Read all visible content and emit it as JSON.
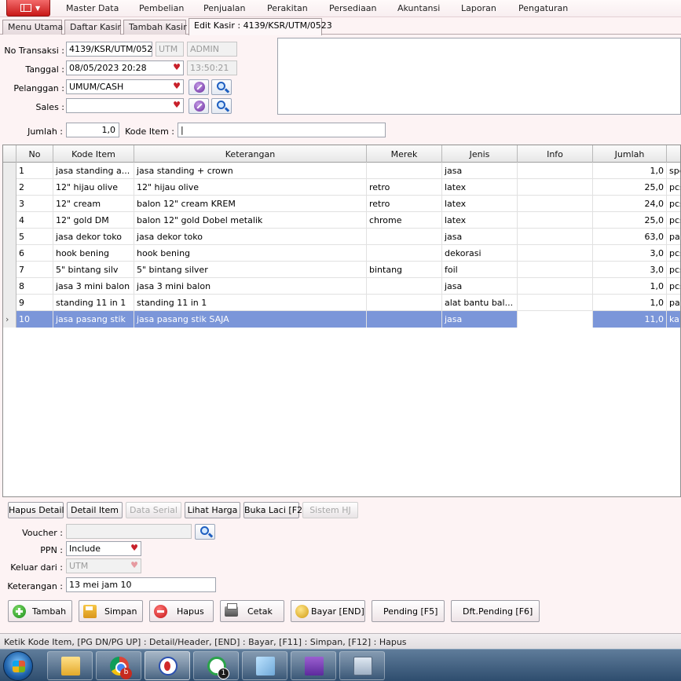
{
  "menu": {
    "items": [
      "Master Data",
      "Pembelian",
      "Penjualan",
      "Perakitan",
      "Persediaan",
      "Akuntansi",
      "Laporan",
      "Pengaturan"
    ]
  },
  "tabs": [
    "Menu Utama",
    "Daftar Kasir",
    "Tambah Kasir",
    "Edit Kasir : 4139/KSR/UTM/0523"
  ],
  "header": {
    "no_transaksi_label": "No Transaksi :",
    "no_transaksi": "4139/KSR/UTM/0523",
    "branch": "UTM",
    "user": "ADMIN",
    "tanggal_label": "Tanggal :",
    "tanggal": "08/05/2023 20:28",
    "time": "13:50:21",
    "pelanggan_label": "Pelanggan :",
    "pelanggan": "UMUM/CASH",
    "sales_label": "Sales :",
    "sales": "",
    "jumlah_label": "Jumlah :",
    "jumlah": "1,0",
    "kode_item_label": "Kode Item :",
    "kode_item": "|"
  },
  "grid": {
    "columns": [
      "No",
      "Kode Item",
      "Keterangan",
      "Merek",
      "Jenis",
      "Info",
      "Jumlah"
    ],
    "rows": [
      {
        "no": "1",
        "kode": "jasa standing a...",
        "ket": "jasa standing  + crown",
        "merek": "",
        "jenis": "jasa",
        "info": "",
        "jumlah": "1,0",
        "satuan": "spe"
      },
      {
        "no": "2",
        "kode": "12\" hijau olive",
        "ket": "12\" hijau olive",
        "merek": "retro",
        "jenis": "latex",
        "info": "",
        "jumlah": "25,0",
        "satuan": "pcs"
      },
      {
        "no": "3",
        "kode": "12\" cream",
        "ket": "balon 12\" cream KREM",
        "merek": "retro",
        "jenis": "latex",
        "info": "",
        "jumlah": "24,0",
        "satuan": "pcs"
      },
      {
        "no": "4",
        "kode": "12\" gold DM",
        "ket": "balon 12\" gold Dobel metalik",
        "merek": "chrome",
        "jenis": "latex",
        "info": "",
        "jumlah": "25,0",
        "satuan": "pcs"
      },
      {
        "no": "5",
        "kode": "jasa dekor toko",
        "ket": "jasa dekor toko",
        "merek": "",
        "jenis": "jasa",
        "info": "",
        "jumlah": "63,0",
        "satuan": "pa"
      },
      {
        "no": "6",
        "kode": "hook bening",
        "ket": "hook bening",
        "merek": "",
        "jenis": "dekorasi",
        "info": "",
        "jumlah": "3,0",
        "satuan": "pcs"
      },
      {
        "no": "7",
        "kode": "5\" bintang silv",
        "ket": "5\" bintang silver",
        "merek": "bintang",
        "jenis": "foil",
        "info": "",
        "jumlah": "3,0",
        "satuan": "pcs"
      },
      {
        "no": "8",
        "kode": "jasa 3 mini balon",
        "ket": "jasa 3 mini balon",
        "merek": "",
        "jenis": "jasa",
        "info": "",
        "jumlah": "1,0",
        "satuan": "pcs"
      },
      {
        "no": "9",
        "kode": "standing 11 in 1",
        "ket": "standing 11 in 1",
        "merek": "",
        "jenis": "alat bantu bal...",
        "info": "",
        "jumlah": "1,0",
        "satuan": "pa"
      },
      {
        "no": "10",
        "kode": "jasa pasang stik",
        "ket": "jasa pasang stik SAJA",
        "merek": "",
        "jenis": "jasa",
        "info": "",
        "jumlah": "11,0",
        "satuan": "ka"
      }
    ]
  },
  "actions": {
    "hapus_detail": "Hapus Detail",
    "detail_item": "Detail Item",
    "data_serial": "Data Serial",
    "lihat_harga": "Lihat Harga",
    "buka_laci": "Buka Laci [F2]",
    "sistem_hj": "Sistem HJ"
  },
  "footer_form": {
    "voucher_label": "Voucher :",
    "voucher": "",
    "ppn_label": "PPN :",
    "ppn": "Include",
    "keluar_label": "Keluar dari :",
    "keluar": "UTM",
    "keterangan_label": "Keterangan :",
    "keterangan": "13 mei jam 10"
  },
  "buttons": {
    "tambah": "Tambah",
    "simpan": "Simpan",
    "hapus": "Hapus",
    "cetak": "Cetak",
    "bayar": "Bayar [END]",
    "pending": "Pending [F5]",
    "dft_pending": "Dft.Pending [F6]"
  },
  "statusbar": "Ketik Kode Item, [PG DN/PG UP] : Detail/Header, [END] : Bayar, [F11] : Simpan, [F12] : Hapus",
  "taskbar": {
    "chrome_badge": "b",
    "whatsapp_badge": "1"
  }
}
